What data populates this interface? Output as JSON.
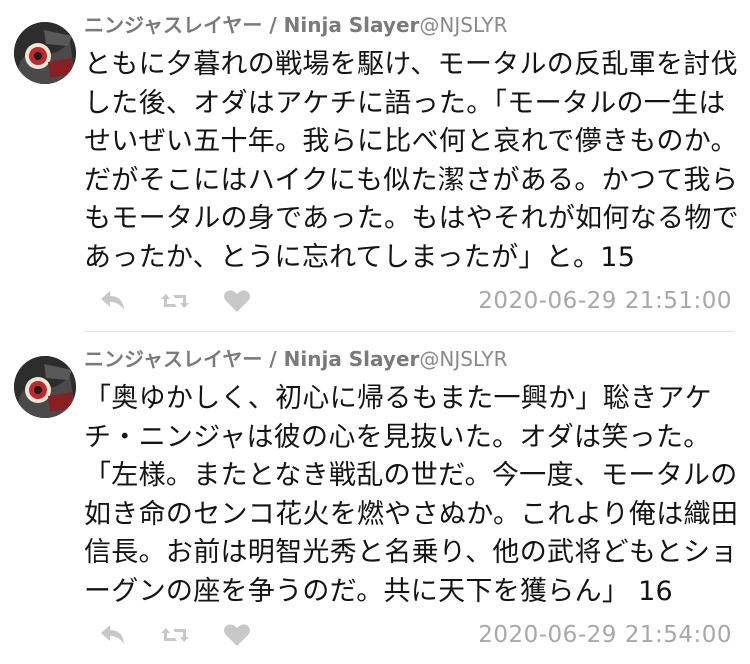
{
  "tweets": [
    {
      "display_name": "ニンジャスレイヤー / Ninja Slayer",
      "handle": "@NJSLYR",
      "avatar_text": "Ninja Slayer",
      "text": "ともに夕暮れの戦場を駆け、モータルの反乱軍を討伐\nした後、オダはアケチに語った。「モータルの一生は\nせいぜい五十年。我らに比べ何と哀れで儚きものか。\nだがそこにはハイクにも似た潔さがある。かつて我ら\nもモータルの身であった。もはやそれが如何なる物で\nあったか、とうに忘れてしまったが」と。15",
      "timestamp": "2020-06-29 21:51:00"
    },
    {
      "display_name": "ニンジャスレイヤー / Ninja Slayer",
      "handle": "@NJSLYR",
      "avatar_text": "Ninja Slayer",
      "text": "「奥ゆかしく、初心に帰るもまた一興か」聡きアケ\nチ・ニンジャは彼の心を見抜いた。オダは笑った。\n「左様。またとなき戦乱の世だ。今一度、モータルの\n如き命のセンコ花火を燃やさぬか。これより俺は織田\n信長。お前は明智光秀と名乗り、他の武将どもとショ\nーグンの座を争うのだ。共に天下を獲らん」 16",
      "timestamp": "2020-06-29 21:54:00"
    }
  ],
  "icons": {
    "reply": "reply-icon",
    "retweet": "retweet-icon",
    "like": "heart-icon"
  },
  "colors": {
    "text": "#141414",
    "name": "#7a7a7a",
    "muted": "#a8a8a8",
    "icon": "#c8c8c8",
    "avatar_accent": "#c0282d"
  }
}
